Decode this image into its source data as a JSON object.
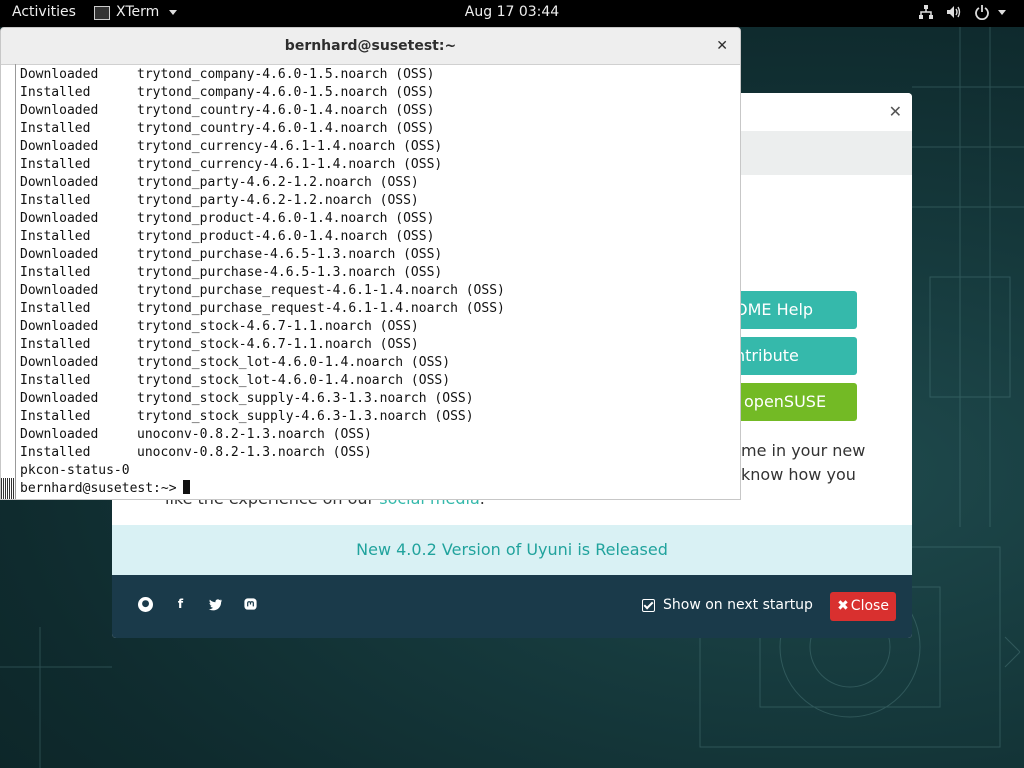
{
  "topbar": {
    "activities": "Activities",
    "app_name": "XTerm",
    "clock": "Aug 17  03:44"
  },
  "welcome": {
    "buttons": {
      "help": "OME Help",
      "contribute": "ntribute",
      "opensuse": "openSUSE"
    },
    "text": {
      "line1": "me in your new",
      "line2": "know how you",
      "line3_prefix": "like the experience on our ",
      "line3_link": "social media",
      "line3_suffix": "."
    },
    "news": "New 4.0.2 Version of Uyuni is Released",
    "show_on_startup": "Show on next startup",
    "close_label": "Close",
    "social_icons": [
      "reddit-icon",
      "facebook-icon",
      "twitter-icon",
      "mastodon-icon"
    ],
    "colors": {
      "teal": "#35b9ab",
      "green": "#73ba25",
      "footer": "#1a3a4a",
      "close": "#d9302f"
    }
  },
  "xterm": {
    "title": "bernhard@susetest:~",
    "lines": [
      {
        "action": "Downloaded",
        "pkg": "trytond_company-4.6.0-1.5.noarch (OSS)"
      },
      {
        "action": "Installed",
        "pkg": "trytond_company-4.6.0-1.5.noarch (OSS)"
      },
      {
        "action": "Downloaded",
        "pkg": "trytond_country-4.6.0-1.4.noarch (OSS)"
      },
      {
        "action": "Installed",
        "pkg": "trytond_country-4.6.0-1.4.noarch (OSS)"
      },
      {
        "action": "Downloaded",
        "pkg": "trytond_currency-4.6.1-1.4.noarch (OSS)"
      },
      {
        "action": "Installed",
        "pkg": "trytond_currency-4.6.1-1.4.noarch (OSS)"
      },
      {
        "action": "Downloaded",
        "pkg": "trytond_party-4.6.2-1.2.noarch (OSS)"
      },
      {
        "action": "Installed",
        "pkg": "trytond_party-4.6.2-1.2.noarch (OSS)"
      },
      {
        "action": "Downloaded",
        "pkg": "trytond_product-4.6.0-1.4.noarch (OSS)"
      },
      {
        "action": "Installed",
        "pkg": "trytond_product-4.6.0-1.4.noarch (OSS)"
      },
      {
        "action": "Downloaded",
        "pkg": "trytond_purchase-4.6.5-1.3.noarch (OSS)"
      },
      {
        "action": "Installed",
        "pkg": "trytond_purchase-4.6.5-1.3.noarch (OSS)"
      },
      {
        "action": "Downloaded",
        "pkg": "trytond_purchase_request-4.6.1-1.4.noarch (OSS)"
      },
      {
        "action": "Installed",
        "pkg": "trytond_purchase_request-4.6.1-1.4.noarch (OSS)"
      },
      {
        "action": "Downloaded",
        "pkg": "trytond_stock-4.6.7-1.1.noarch (OSS)"
      },
      {
        "action": "Installed",
        "pkg": "trytond_stock-4.6.7-1.1.noarch (OSS)"
      },
      {
        "action": "Downloaded",
        "pkg": "trytond_stock_lot-4.6.0-1.4.noarch (OSS)"
      },
      {
        "action": "Installed",
        "pkg": "trytond_stock_lot-4.6.0-1.4.noarch (OSS)"
      },
      {
        "action": "Downloaded",
        "pkg": "trytond_stock_supply-4.6.3-1.3.noarch (OSS)"
      },
      {
        "action": "Installed",
        "pkg": "trytond_stock_supply-4.6.3-1.3.noarch (OSS)"
      },
      {
        "action": "Downloaded",
        "pkg": "unoconv-0.8.2-1.3.noarch (OSS)"
      },
      {
        "action": "Installed",
        "pkg": "unoconv-0.8.2-1.3.noarch (OSS)"
      }
    ],
    "status_line": "pkcon-status-0",
    "prompt": "bernhard@susetest:~>"
  }
}
